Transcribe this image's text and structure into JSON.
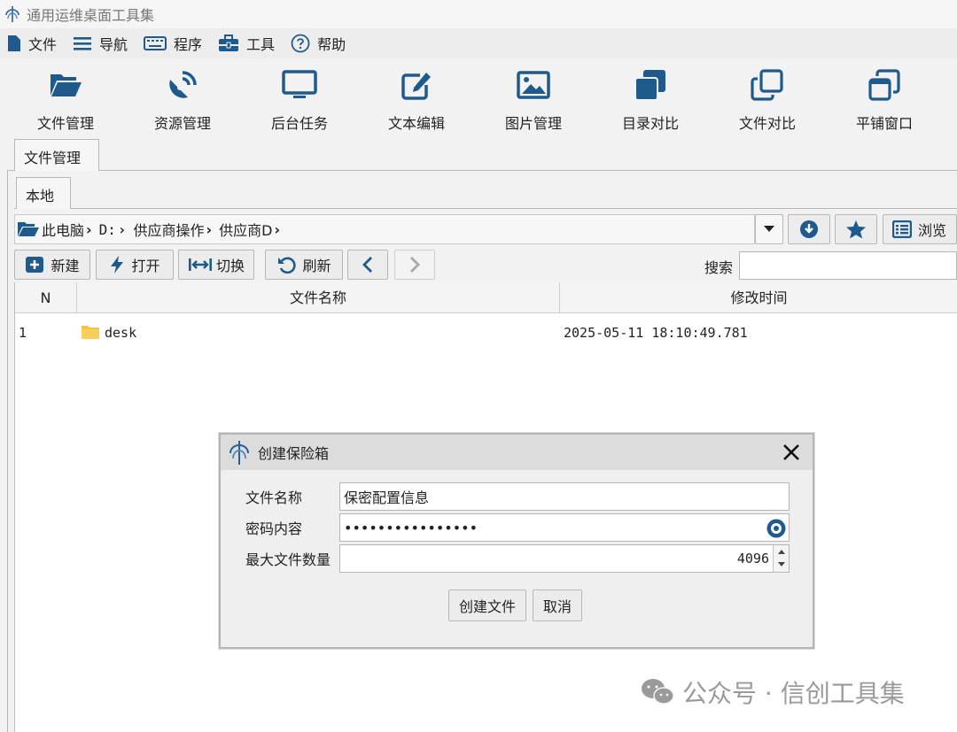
{
  "window": {
    "title": "通用运维桌面工具集"
  },
  "menu": [
    {
      "label": "文件",
      "icon": "file-icon"
    },
    {
      "label": "导航",
      "icon": "list-icon"
    },
    {
      "label": "程序",
      "icon": "keyboard-icon"
    },
    {
      "label": "工具",
      "icon": "toolbox-icon"
    },
    {
      "label": "帮助",
      "icon": "help-icon"
    }
  ],
  "toolbar": [
    {
      "label": "文件管理",
      "icon": "folder-open-icon"
    },
    {
      "label": "资源管理",
      "icon": "satellite-dish-icon"
    },
    {
      "label": "后台任务",
      "icon": "monitor-icon"
    },
    {
      "label": "文本编辑",
      "icon": "edit-icon"
    },
    {
      "label": "图片管理",
      "icon": "image-icon"
    },
    {
      "label": "目录对比",
      "icon": "clone-solid-icon"
    },
    {
      "label": "文件对比",
      "icon": "clone-outline-icon"
    },
    {
      "label": "平铺窗口",
      "icon": "window-restore-icon"
    }
  ],
  "tabs": {
    "main": "文件管理",
    "sub": "本地"
  },
  "path": {
    "crumbs": [
      "此电脑",
      "D:",
      "供应商操作",
      "供应商D"
    ],
    "browse_label": "浏览"
  },
  "actions": {
    "new": "新建",
    "open": "打开",
    "switch": "切换",
    "refresh": "刷新",
    "search_label": "搜索",
    "search_value": ""
  },
  "table": {
    "headers": [
      "N",
      "文件名称",
      "修改时间"
    ],
    "rows": [
      {
        "n": "1",
        "name": "desk",
        "modified": "2025-05-11 18:10:49.781"
      }
    ]
  },
  "dialog": {
    "title": "创建保险箱",
    "file_name_label": "文件名称",
    "file_name_value": "保密配置信息",
    "password_label": "密码内容",
    "password_value": "••••••••••••••••",
    "max_files_label": "最大文件数量",
    "max_files_value": "4096",
    "create_button": "创建文件",
    "cancel_button": "取消"
  },
  "watermark": {
    "text": "公众号 · 信创工具集"
  },
  "colors": {
    "icon_blue": "#1f5a8c",
    "folder_yellow": "#f5c343"
  }
}
